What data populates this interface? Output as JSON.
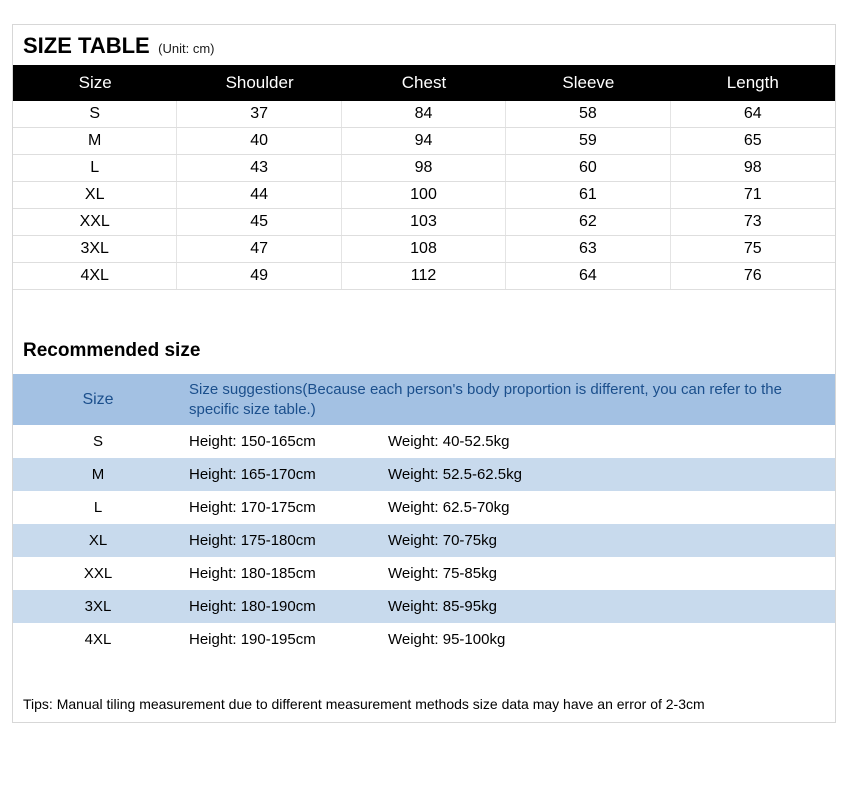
{
  "chart_data": [
    {
      "type": "table",
      "title": "SIZE TABLE",
      "unit": "(Unit: cm)",
      "headers": [
        "Size",
        "Shoulder",
        "Chest",
        "Sleeve",
        "Length"
      ],
      "rows": [
        [
          "S",
          "37",
          "84",
          "58",
          "64"
        ],
        [
          "M",
          "40",
          "94",
          "59",
          "65"
        ],
        [
          "L",
          "43",
          "98",
          "60",
          "98"
        ],
        [
          "XL",
          "44",
          "100",
          "61",
          "71"
        ],
        [
          "XXL",
          "45",
          "103",
          "62",
          "73"
        ],
        [
          "3XL",
          "47",
          "108",
          "63",
          "75"
        ],
        [
          "4XL",
          "49",
          "112",
          "64",
          "76"
        ]
      ]
    },
    {
      "type": "table",
      "title": "Recommended size",
      "headers": [
        "Size",
        "Size suggestions(Because each person's body proportion is different, you can refer to the specific size table.)"
      ],
      "rows": [
        [
          "S",
          "Height: 150-165cm",
          "Weight: 40-52.5kg"
        ],
        [
          "M",
          "Height: 165-170cm",
          "Weight: 52.5-62.5kg"
        ],
        [
          "L",
          "Height: 170-175cm",
          "Weight: 62.5-70kg"
        ],
        [
          "XL",
          "Height: 175-180cm",
          "Weight: 70-75kg"
        ],
        [
          "XXL",
          "Height: 180-185cm",
          "Weight: 75-85kg"
        ],
        [
          "3XL",
          "Height: 180-190cm",
          "Weight: 85-95kg"
        ],
        [
          "4XL",
          "Height: 190-195cm",
          "Weight: 95-100kg"
        ]
      ]
    }
  ],
  "tips": "Tips: Manual tiling measurement due to different measurement methods size data may have an error of 2-3cm"
}
